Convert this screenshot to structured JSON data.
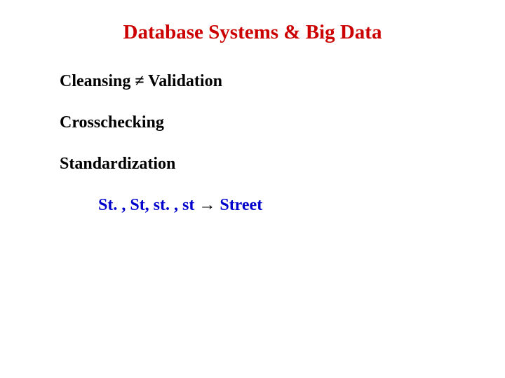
{
  "title": "Database Systems & Big Data",
  "line1_part1": "Cleansing ",
  "line1_neq": "≠",
  "line1_part2": " Validation",
  "line2": "Crosschecking",
  "line3": "Standardization",
  "line4_part1": "St. , St, st. , st ",
  "line4_arrow": "→",
  "line4_part2": " Street"
}
